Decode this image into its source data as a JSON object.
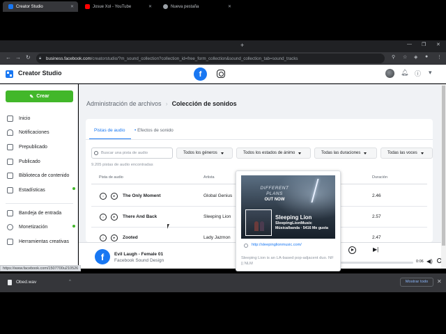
{
  "browser": {
    "tabs": [
      {
        "label": "Creator Studio",
        "icon": "facebook-creator-icon",
        "active": true
      },
      {
        "label": "Josue Xol - YouTube",
        "icon": "youtube-icon",
        "active": false
      },
      {
        "label": "Nueva pestaña",
        "icon": "chrome-icon",
        "active": false
      }
    ],
    "url_host": "business.facebook.com",
    "url_path": "/creatorstudio/?m_sound_collection?collection_id=free_form_collection&sound_collection_tab=sound_tracks"
  },
  "app": {
    "title": "Creator Studio",
    "brand_color": "#1877f2",
    "create_label": "Crear",
    "create_color": "#42b72a"
  },
  "sidebar": {
    "items": [
      {
        "label": "Inicio",
        "icon": "home-icon"
      },
      {
        "label": "Notificaciones",
        "icon": "bell-icon"
      },
      {
        "label": "Prepublicado",
        "icon": "document-icon"
      },
      {
        "label": "Publicado",
        "icon": "published-icon"
      },
      {
        "label": "Biblioteca de contenido",
        "icon": "library-icon"
      },
      {
        "label": "Estadísticas",
        "icon": "stats-icon"
      },
      {
        "label": "Bandeja de entrada",
        "icon": "inbox-icon"
      },
      {
        "label": "Monetización",
        "icon": "money-icon"
      },
      {
        "label": "Herramientas creativas",
        "icon": "tools-icon"
      }
    ]
  },
  "breadcrumb": {
    "parent": "Administración de archivos",
    "current": "Colección de sonidos"
  },
  "tabs": {
    "audio": "Pistas de audio",
    "effects": "Efectos de sonido"
  },
  "filters": {
    "search_placeholder": "Buscar una pista de audio",
    "genres": "Todos los géneros",
    "moods": "Todos los estados de ánimo",
    "durations": "Todas las duraciones",
    "voices": "Todas las voces"
  },
  "count_text": "9.205 pistas de audio encontradas",
  "table": {
    "headers": {
      "title": "Pista de audio",
      "artist": "Artista",
      "duration": "Duración"
    },
    "rows": [
      {
        "title": "The Only Moment",
        "artist": "Global Genius",
        "duration": "2.46"
      },
      {
        "title": "There And Back",
        "artist": "Sleeping Lion",
        "duration": "2.57"
      },
      {
        "title": "Zooted",
        "artist": "Lady Jazmon",
        "duration": "2.47"
      }
    ]
  },
  "popup": {
    "album_line1": "DIFFERENT",
    "album_line2": "PLANS",
    "album_out": "OUT NOW",
    "name": "Sleeping Lion",
    "username": "SleepingLionMusic",
    "meta": "Música/banda · 5416 Me gusta",
    "link": "http://sleepinglionmusic.com/",
    "description": "Sleeping Lion is an LA-based pop-adjacent duo. NF || NLM"
  },
  "player": {
    "title": "Evil Laugh - Female 01",
    "subtitle": "Facebook Sound Design",
    "time": "0:06"
  },
  "status_url": "https://www.facebook.com/1507700u210526",
  "download": {
    "file": "Obed.wav",
    "show_all": "Mostrar todo"
  }
}
